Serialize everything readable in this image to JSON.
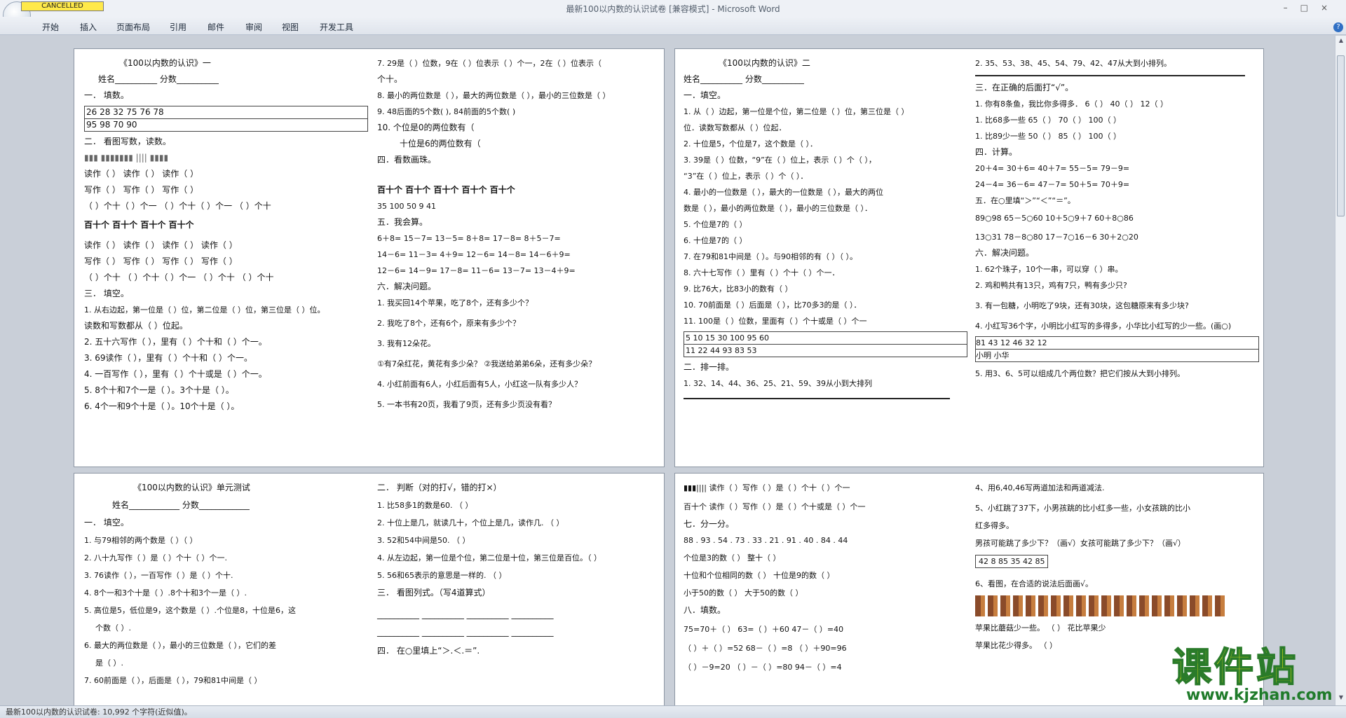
{
  "window": {
    "title": "最新100以内数的认识试卷 [兼容模式] - Microsoft Word",
    "cancel_badge": "CANCELLED"
  },
  "ribbon": {
    "tabs": [
      "开始",
      "插入",
      "页面布局",
      "引用",
      "邮件",
      "审阅",
      "视图",
      "开发工具"
    ]
  },
  "pages": [
    {
      "left": [
        "《100以内数的认识》一",
        "姓名__________       分数__________",
        "一．  填数。",
        "26  28    32     75  76  78",
        "  95    98        70     90",
        "二．  看图写数，读数。",
        "▮▮▮         ▮▮▮▮▮▮▮ ||||        ▮▮▮▮",
        "读作（   ）        读作（   ）         读作（   ）",
        "写作（   ）        写作（   ）         写作（   ）",
        "（  ）个十（  ）个一     （  ）个十（  ）个一     （  ）个十",
        "百十个      百十个        百十个        百十个",
        "读作（   ）     读作（   ）     读作（   ）     读作（   ）",
        "写作（   ）     写作（   ）     写作（   ）     写作（   ）",
        "（  ）个十     （  ）个十（  ）个一     （  ）个十     （  ）个十",
        "三．  填空。",
        "1. 从右边起，第一位是（  ）位，第二位是（  ）位，第三位是（  ）位。",
        "读数和写数都从（  ）位起。",
        "2. 五十六写作（    ），里有（    ）个十和（    ）个一。",
        "3. 69读作（        ），里有（    ）个十和（    ）个一。",
        "4. 一百写作（    ），里有（    ）个十或是（    ）个一。",
        "5. 8个十和7个一是（    ）。3个十是（    ）。",
        "6. 4个一和9个十是（    ）。10个十是（    ）。"
      ],
      "right": [
        "7. 29是（   ）位数，9在（   ）位表示（   ）个一，2在（   ）位表示（",
        "个十。",
        "8. 最小的两位数是（   ），最大的两位数是（   ），最小的三位数是（   ）",
        "9. 48后面的5个数(              ), 84前面的5个数(              )",
        "10. 个位是0的两位数有（",
        "十位是6的两位数有（",
        "四．看数画珠。",
        "百十个     百十个      百十个      百十个      百十个",
        "35          100           50             9            41",
        "五．我会算。",
        "6＋8=       15－7=       13－5=       8＋8=       17－8=       8＋5－7=",
        "14－6=      11－3=       4＋9=        12－6=      14－8=       14－6＋9=",
        "12－6=      14－9=       17－8=       11－6=      13－7=       13－4＋9=",
        "六．解决问题。",
        "1. 我买回14个苹果，吃了8个，还有多少个？",
        "2. 我吃了8个，还有6个，原来有多少个？",
        "3. 我有12朵花。",
        "①有7朵红花，黄花有多少朵？        ②我送给弟弟6朵，还有多少朵？",
        "4. 小红前面有6人，小红后面有5人，小红这一队有多少人？",
        "5. 一本书有20页，我看了9页，还有多少页没有看？"
      ]
    },
    {
      "left": [
        "《100以内数的认识》二",
        "姓名__________          分数__________",
        "一．填空。",
        "1. 从（  ）边起，第一位是个位，第二位是（    ）位，第三位是（    ）",
        "位．读数写数都从（    ）位起．",
        "2. 十位是5，个位是7，这个数是（        ）．",
        "3. 39是（    ）位数，“9”在（    ）位上，表示（    ）个（    ），",
        "“3”在（    ）位上，表示（    ）个（    ）．",
        "4. 最小的一位数是（    ），最大的一位数是（    ），最大的两位",
        "数是（    ），最小的两位数是（    ），最小的三位数是（    ）．",
        "5. 个位是7的（                                                    ）",
        "6. 十位是7的（                                                    ）",
        "7. 在79和81中间是（    ）。与90相邻的有（        ）（        ）。",
        "8. 六十七写作（    ）里有（    ）个十（    ）个一．",
        "9. 比76大，比83小的数有（                                         ）",
        "10. 70前面是（        ）后面是（        ），比70多3的是（        ）．",
        "11. 100是（    ）位数，里面有（    ）个十或是（        ）个一",
        "5  10  15     30          100  95     60",
        "11  22    44                93  83     53",
        "二．排一排。",
        "1. 32、14、44、36、25、21、59、39从小到大排列"
      ],
      "right": [
        "2. 35、53、38、45、54、79、42、47从大到小排列。",
        "三．在正确的后面打“√”。",
        "1. 你有8条鱼，我比你多得多．   6（   ）   40（   ）   12（   ）",
        "1. 比68多一些                   65（   ）   70（   ）   100（   ）",
        "1. 比89少一些          50（   ）      85（   ）      100（   ）",
        "四．计算。",
        "20＋4=           30＋6=           40＋7=           55－5=           79－9=",
        "24－4=           36－6=           47－7=           50＋5=           70＋9=",
        "五．在○里填“＞”“＜”“＝”。",
        "89○98        65－5○60        10＋5○9＋7      60＋8○86",
        "13○31        78－8○80        17－7○16－6      30＋2○20",
        "六．解决问题。",
        "1. 62个珠子，10个一串，可以穿（    ）串。",
        "2. 鸡和鸭共有13只，鸡有7只，鸭有多少只?",
        "3. 有一包糖，小明吃了9块，还有30块，这包糖原来有多少块?",
        "4. 小红写36个字，小明比小红写的多得多，小华比小红写的少一些。(画○)",
        "        81   43   12                   46   32   12",
        "小明                              小华",
        "5. 用3、6、5可以组成几个两位数？把它们按从大到小排列。"
      ]
    },
    {
      "left": [
        "《100以内数的认识》单元测试",
        "姓名____________        分数____________",
        "一．  填空。",
        "1. 与79相邻的两个数是（  ）（  ）",
        "2. 八十九写作（    ）是（    ）个十（    ）个一.",
        "3. 76读作（    ），一百写作（    ）是（    ）个十.",
        "4. 8个一和3个十是（    ）.8个十和3个一是（    ）.",
        "5. 高位是5，低位是9，这个数是（    ）.个位是8，十位是6，这",
        "个数（    ）.",
        "6. 最大的两位数是（    ），最小的三位数是（    ），它们的差",
        "是（    ）.",
        "7. 60前面是（    ），后面是（    ），79和81中间是（    ）"
      ],
      "right": [
        "二．  判断（对的打√，错的打×）",
        "1. 比58多1的数是60.                                   （          ）",
        "2. 十位上是几，就读几十，个位上是几，读作几.        （          ）",
        "3. 52和54中间是50.                                    （          ）",
        "4. 从左边起，第一位是个位，第二位是十位，第三位是百位。（          ）",
        "5. 56和65表示的意思是一样的.                          （          ）",
        "三．  看图列式。（写4道算式）",
        "__________     __________       __________    __________",
        "__________     __________       __________    __________",
        "四．   在○里填上“＞.＜.＝”."
      ]
    },
    {
      "left": [
        "▮▮▮||||   读作（    ）写作（    ）是（    ）个十（    ）个一",
        "百十个     读作（    ）写作（    ）是（    ）个十或是（    ）个一",
        "七．分一分。",
        "88 . 93 . 54 . 73 . 33 . 21 .  91 . 40 . 84 . 44",
        "个位是3的数（                    ）   整十（                    ）",
        "十位和个位相同的数（              ）  十位是9的数（              ）",
        "小于50的数（                    ）   大于50的数（                ）",
        "八．填数。",
        "75=70＋（  ）        63=（  ）＋60      47－（  ）=40",
        "（  ）＋（  ）=52    68－（  ）=8       （  ）＋90=96",
        "（  ）－9=20       （  ）－（  ）=80     94－（  ）=4"
      ],
      "right": [
        "4、用6,40,46写两道加法和两道减法.",
        "5、小红跳了37下，小男孩跳的比小红多一些，小女孩跳的比小",
        "红多得多。",
        "男孩可能跳了多少下？（画√）女孩可能跳了多少下？（画√）",
        "42   8   85          35   42   85",
        "6、看图，在合适的说法后面画√。",
        "苹果比蘑菇少一些。  （    ）        花比苹果少",
        "苹果比花少得多。  （    ）"
      ]
    }
  ],
  "status": {
    "text": "最新100以内数的认识试卷: 10,992 个字符(近似值)。"
  },
  "watermark": {
    "cn": "课件站",
    "url": "www.kjzhan.com"
  }
}
